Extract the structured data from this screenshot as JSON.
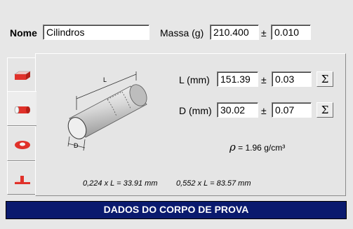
{
  "header": {
    "nome_label": "Nome",
    "nome_value": "Cilindros",
    "massa_label": "Massa (g)",
    "massa_value": "210.400",
    "plusminus": "±",
    "massa_tol": "0.010"
  },
  "tabs": [
    {
      "name": "block-shape-icon",
      "active": false
    },
    {
      "name": "cylinder-shape-icon",
      "active": true
    },
    {
      "name": "ring-shape-icon",
      "active": false
    },
    {
      "name": "irregular-shape-icon",
      "active": false
    }
  ],
  "panel": {
    "diagram_label_L": "L",
    "diagram_label_D": "D",
    "L_label": "L (mm)",
    "L_value": "151.39",
    "L_tol": "0.03",
    "D_label": "D (mm)",
    "D_value": "30.02",
    "D_tol": "0.07",
    "sigma": "Σ",
    "rho_symbol": "ρ",
    "rho_text": " = 1.96 g/cm³",
    "note_left": "0,224 x L  = 33.91 mm",
    "note_right": "0,552 x L = 83.57 mm"
  },
  "footer": {
    "title": "DADOS DO CORPO DE PROVA"
  },
  "colors": {
    "background": "#e7e7e7",
    "footer_bg": "#0a1a6e",
    "icon_red": "#e0312a"
  }
}
